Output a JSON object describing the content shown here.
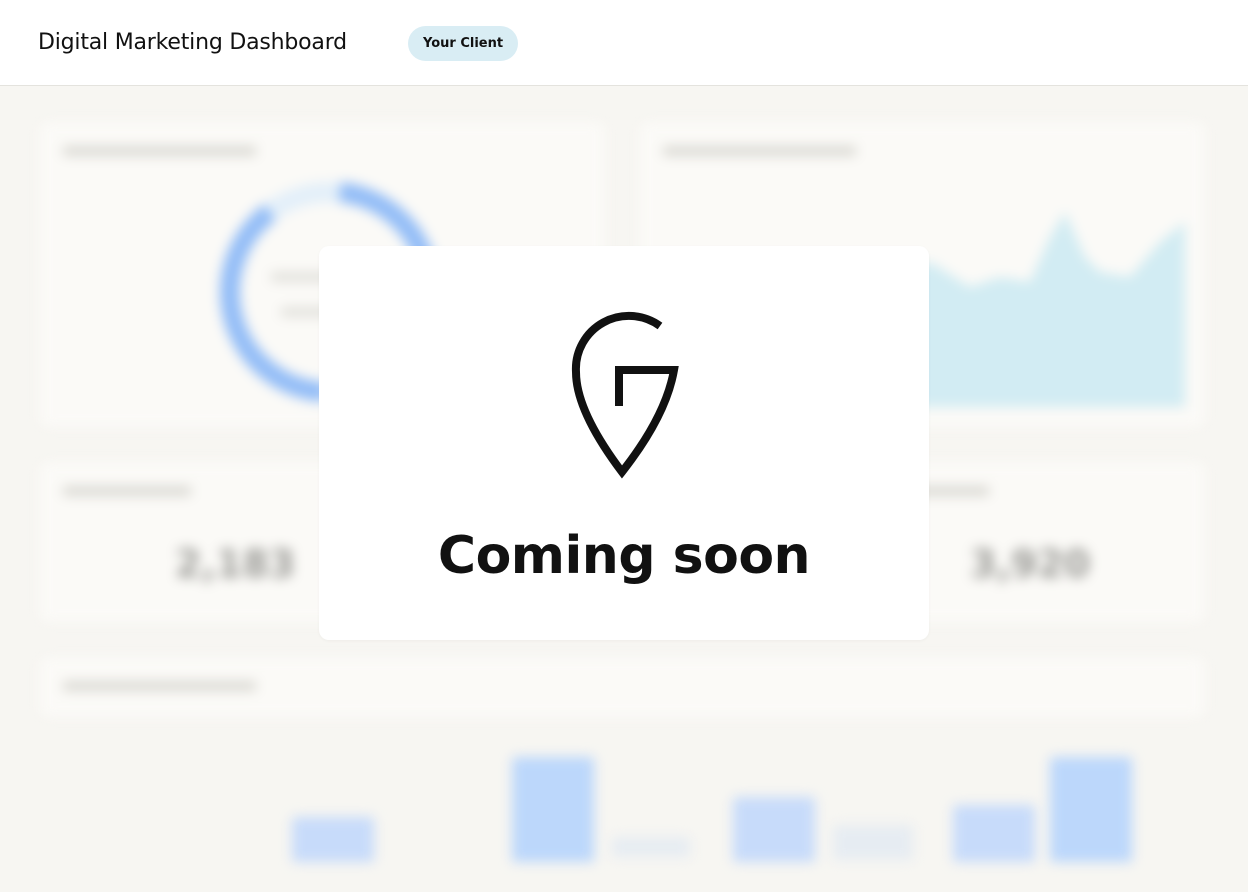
{
  "header": {
    "title": "Digital Marketing Dashboard",
    "client_badge": "Your Client"
  },
  "background": {
    "metric_left": "2,183",
    "metric_right": "3,920"
  },
  "modal": {
    "logo_icon": "location-pin-g-logo",
    "message": "Coming soon"
  },
  "colors": {
    "badge_bg": "#d9edf4",
    "donut_blue": "#93bdf7",
    "area_fill": "#d2ecf3",
    "bar_blue": "#bcd7fb"
  }
}
